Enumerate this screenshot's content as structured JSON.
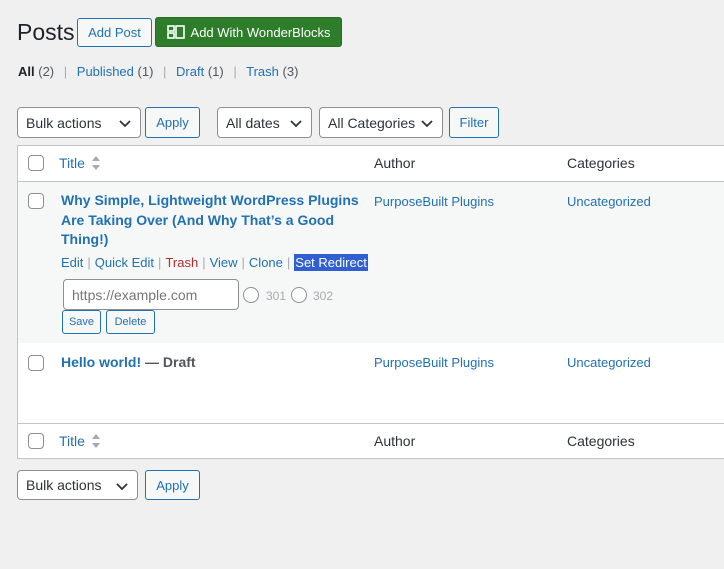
{
  "header": {
    "title": "Posts",
    "add_post": "Add Post",
    "add_wonderblocks": "Add With WonderBlocks"
  },
  "views": {
    "all": "All",
    "all_count": "(2)",
    "published": "Published",
    "published_count": "(1)",
    "draft": "Draft",
    "draft_count": "(1)",
    "trash": "Trash",
    "trash_count": "(3)",
    "separator": "|"
  },
  "filters": {
    "bulk_actions": "Bulk actions",
    "apply": "Apply",
    "all_dates": "All dates",
    "all_categories": "All Categories",
    "filter": "Filter"
  },
  "columns": {
    "title": "Title",
    "author": "Author",
    "categories": "Categories"
  },
  "posts": [
    {
      "title_line1": "Why Simple, Lightweight WordPress Plugins",
      "title_line2": "Are Taking Over (And Why That’s a Good",
      "title_line3": "Thing!)",
      "author": "PurposeBuilt Plugins",
      "category": "Uncategorized",
      "actions": {
        "edit": "Edit",
        "quick_edit": "Quick Edit",
        "trash": "Trash",
        "view": "View",
        "clone": "Clone",
        "set_redirect": "Set Redirect",
        "separator": "|"
      },
      "redirect": {
        "placeholder": "https://example.com",
        "option_301": "301",
        "option_302": "302",
        "save": "Save",
        "delete": "Delete"
      }
    },
    {
      "title": "Hello world!",
      "state": "— Draft",
      "author": "PurposeBuilt Plugins",
      "category": "Uncategorized"
    }
  ],
  "colors": {
    "accent": "#2271b1",
    "green_button": "#2d7d2a",
    "trash_red": "#b32d2e",
    "highlight": "#2f5fd0"
  }
}
